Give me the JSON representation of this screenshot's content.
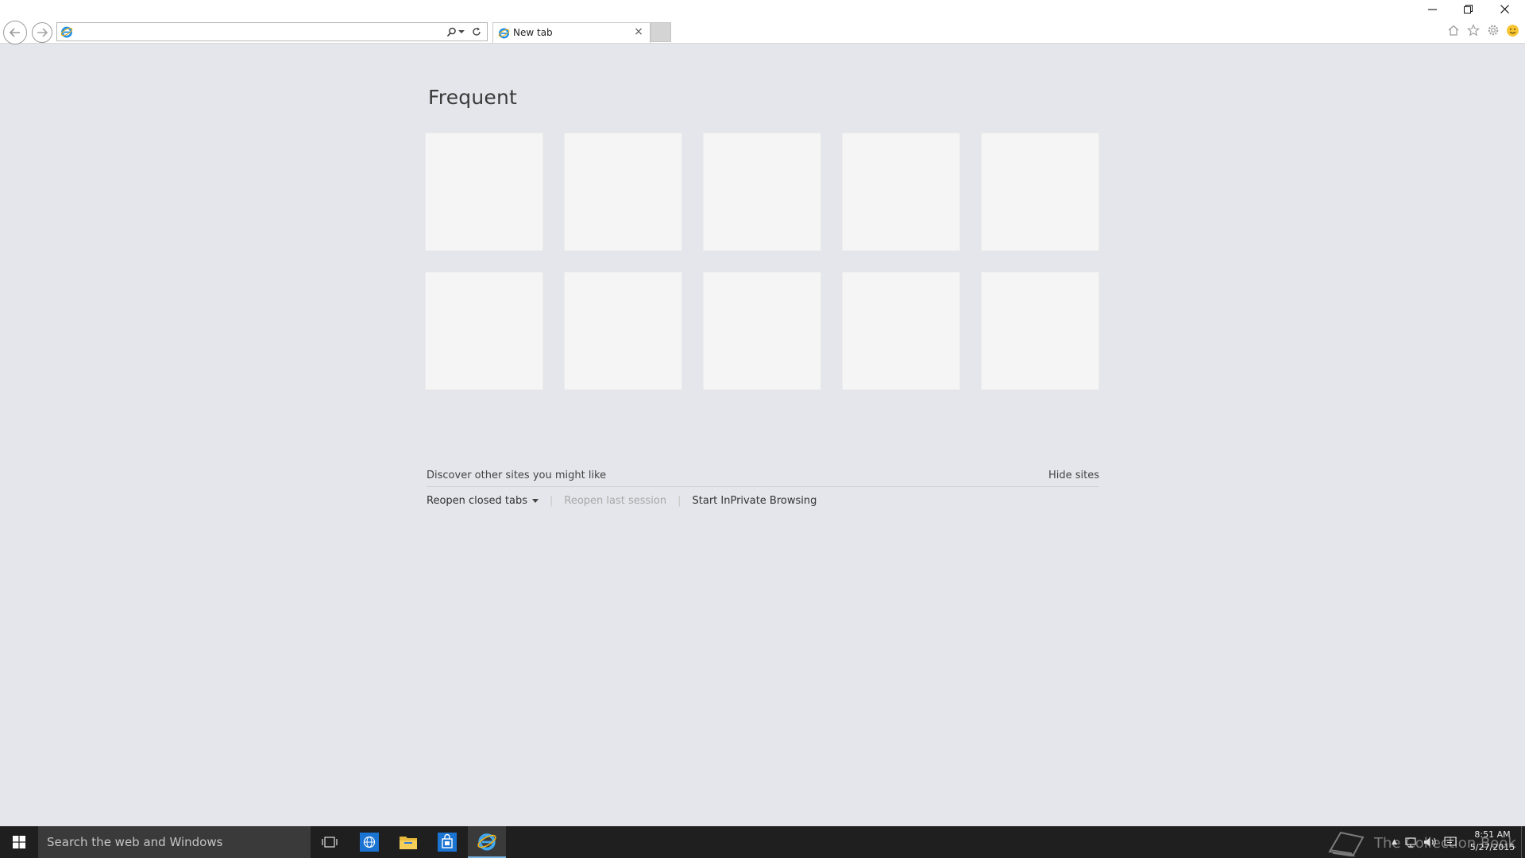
{
  "browser": {
    "address_value": "",
    "tab": {
      "label": "New tab",
      "close_glyph": "×"
    }
  },
  "page": {
    "heading": "Frequent",
    "tile_count": 10,
    "discover_text": "Discover other sites you might like",
    "hide_sites": "Hide sites",
    "reopen_closed_tabs": "Reopen closed tabs",
    "reopen_last_session": "Reopen last session",
    "start_inprivate": "Start InPrivate Browsing"
  },
  "taskbar": {
    "search_placeholder": "Search the web and Windows",
    "watermark": "The Collection Book",
    "time": "8:51 AM",
    "date": "5/27/2015"
  },
  "icons": {
    "back": "back-arrow-icon",
    "forward": "forward-arrow-icon",
    "search": "search-icon",
    "refresh": "refresh-icon",
    "home": "home-icon",
    "favorites": "star-icon",
    "tools": "gear-icon",
    "feedback": "smiley-icon"
  },
  "colors": {
    "page_background": "#e4e6eb",
    "tile_background": "#f5f5f5",
    "taskbar_background": "#1f1f1f",
    "ie_blue": "#1e90e8",
    "ie_gold": "#f0b21a"
  }
}
